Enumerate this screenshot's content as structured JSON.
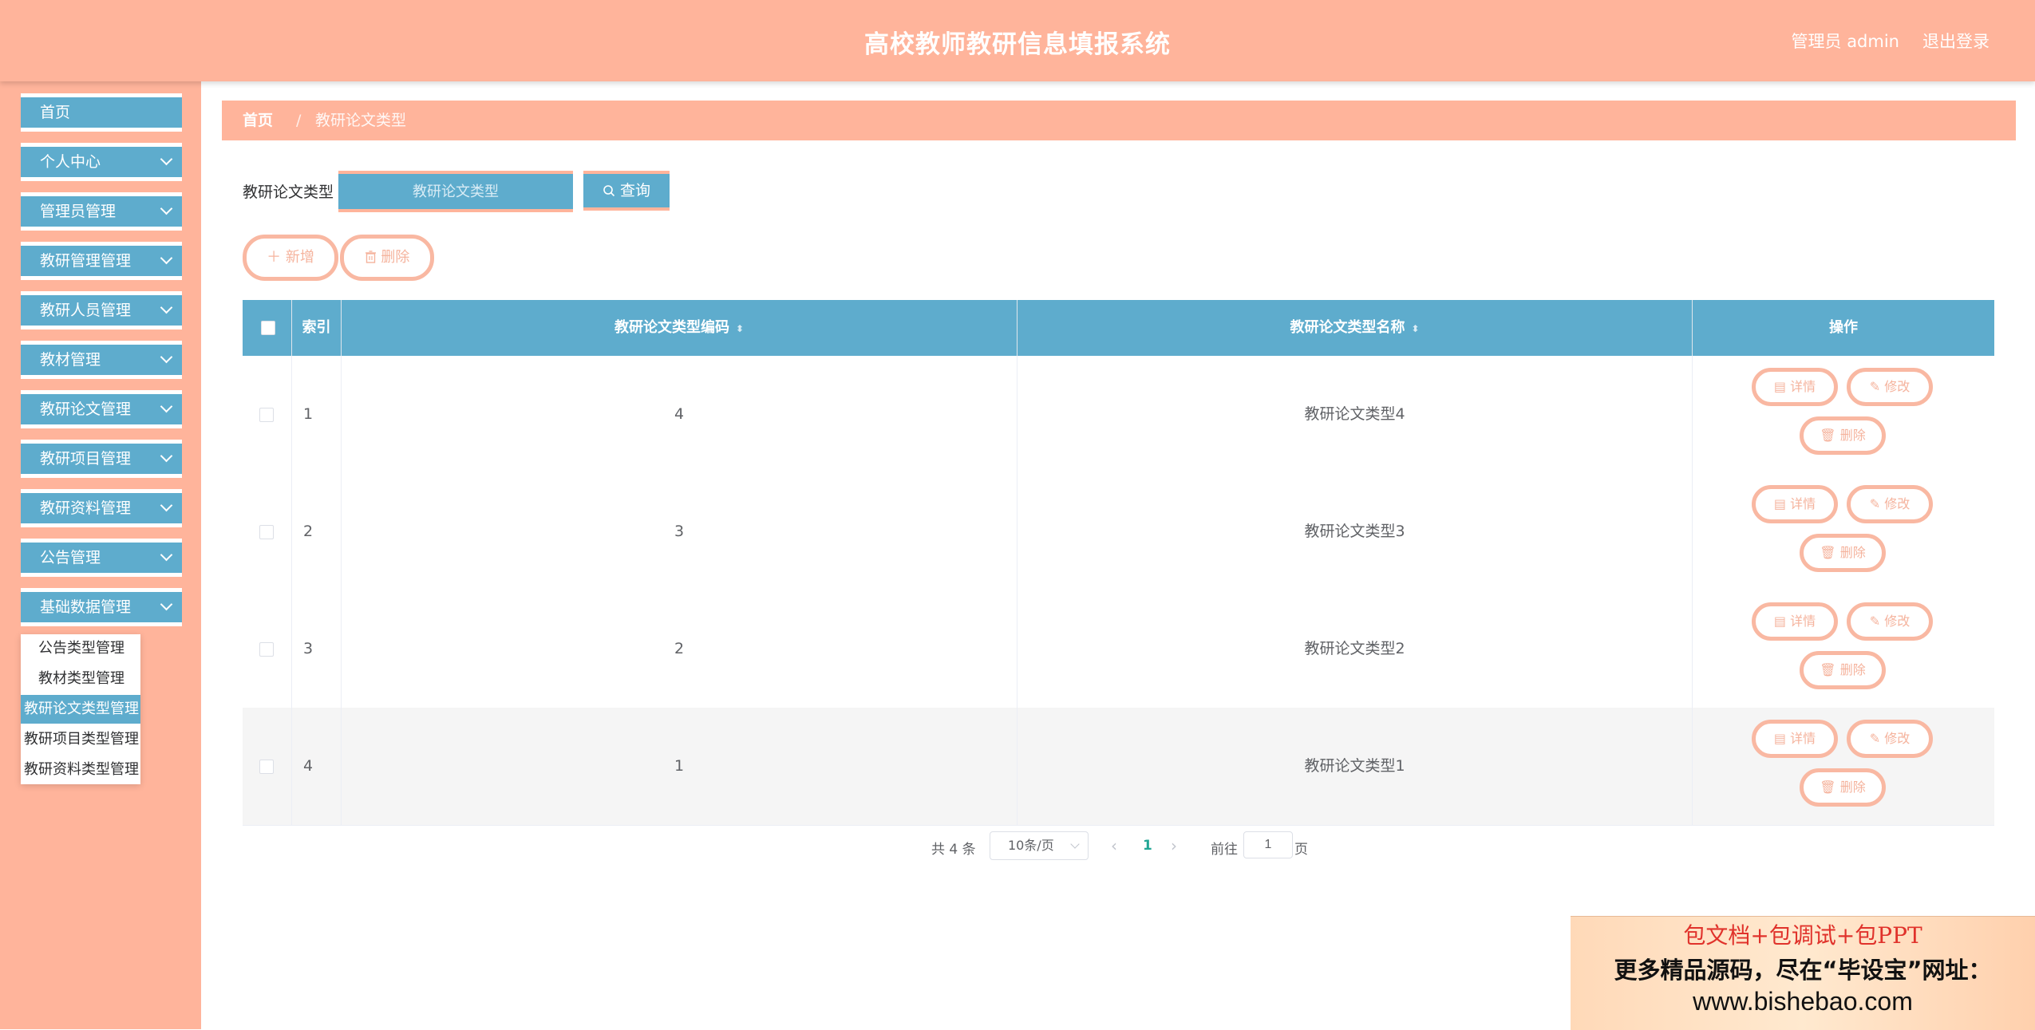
{
  "header": {
    "title": "高校教师教研信息填报系统",
    "user": "管理员 admin",
    "logout": "退出登录"
  },
  "sidebar": {
    "items": [
      {
        "label": "首页",
        "has_children": false
      },
      {
        "label": "个人中心",
        "has_children": true
      },
      {
        "label": "管理员管理",
        "has_children": true
      },
      {
        "label": "教研管理管理",
        "has_children": true
      },
      {
        "label": "教研人员管理",
        "has_children": true
      },
      {
        "label": "教材管理",
        "has_children": true
      },
      {
        "label": "教研论文管理",
        "has_children": true
      },
      {
        "label": "教研项目管理",
        "has_children": true
      },
      {
        "label": "教研资料管理",
        "has_children": true
      },
      {
        "label": "公告管理",
        "has_children": true
      },
      {
        "label": "基础数据管理",
        "has_children": true
      }
    ],
    "submenu": [
      {
        "label": "公告类型管理",
        "active": false
      },
      {
        "label": "教材类型管理",
        "active": false
      },
      {
        "label": "教研论文类型管理",
        "active": true
      },
      {
        "label": "教研项目类型管理",
        "active": false
      },
      {
        "label": "教研资料类型管理",
        "active": false
      }
    ]
  },
  "breadcrumb": {
    "home": "首页",
    "separator": "/",
    "current": "教研论文类型"
  },
  "search": {
    "label": "教研论文类型",
    "placeholder": "教研论文类型",
    "query_label": "查询"
  },
  "toolbar": {
    "add_label": "新增",
    "delete_label": "删除"
  },
  "table": {
    "columns": [
      "索引",
      "教研论文类型编码",
      "教研论文类型名称",
      "操作"
    ],
    "rows": [
      {
        "index": "1",
        "code": "4",
        "name": "教研论文类型4"
      },
      {
        "index": "2",
        "code": "3",
        "name": "教研论文类型3"
      },
      {
        "index": "3",
        "code": "2",
        "name": "教研论文类型2"
      },
      {
        "index": "4",
        "code": "1",
        "name": "教研论文类型1"
      }
    ],
    "actions": {
      "detail": "详情",
      "edit": "修改",
      "delete": "删除"
    }
  },
  "pagination": {
    "total_text": "共 4 条",
    "page_size": "10条/页",
    "current_page": "1",
    "goto_label": "前往",
    "goto_value": "1",
    "page_suffix": "页"
  },
  "banner": {
    "line1": "包文档+包调试+包PPT",
    "line2": "更多精品源码，尽在“毕设宝”网址：",
    "line3": "www.bishebao.com"
  },
  "colors": {
    "accent_salmon": "#ffb49b",
    "menu_blue": "#5eaccd",
    "pager_active": "#22a695"
  }
}
